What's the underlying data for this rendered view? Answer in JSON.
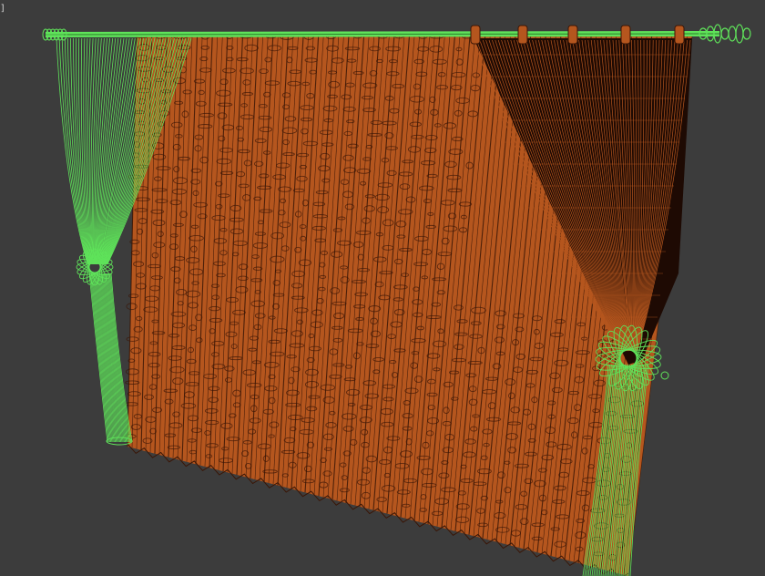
{
  "viewport": {
    "corner_glyph": "]",
    "background_color": "#3c3c3c",
    "scene": "wireframe-curtain-model",
    "colors": {
      "sheer_curtain_wire": "#5fe35a",
      "drape_fill": "#b5561e",
      "drape_wire_dark": "#3a1606",
      "drape_shadow": "#1e0a03",
      "rod": "#5fe35a",
      "rings": "#b5561e"
    },
    "objects": [
      {
        "name": "curtain-rod",
        "color_key": "rod"
      },
      {
        "name": "curtain-rings",
        "count": 5,
        "color_key": "rings"
      },
      {
        "name": "main-drape-panel",
        "color_key": "drape_fill"
      },
      {
        "name": "left-sheer-curtain",
        "color_key": "sheer_curtain_wire"
      },
      {
        "name": "right-sheer-curtain",
        "color_key": "sheer_curtain_wire"
      },
      {
        "name": "right-side-drape",
        "color_key": "drape_fill"
      },
      {
        "name": "left-tieback",
        "color_key": "sheer_curtain_wire"
      },
      {
        "name": "right-tieback",
        "color_key": "sheer_curtain_wire"
      }
    ]
  }
}
